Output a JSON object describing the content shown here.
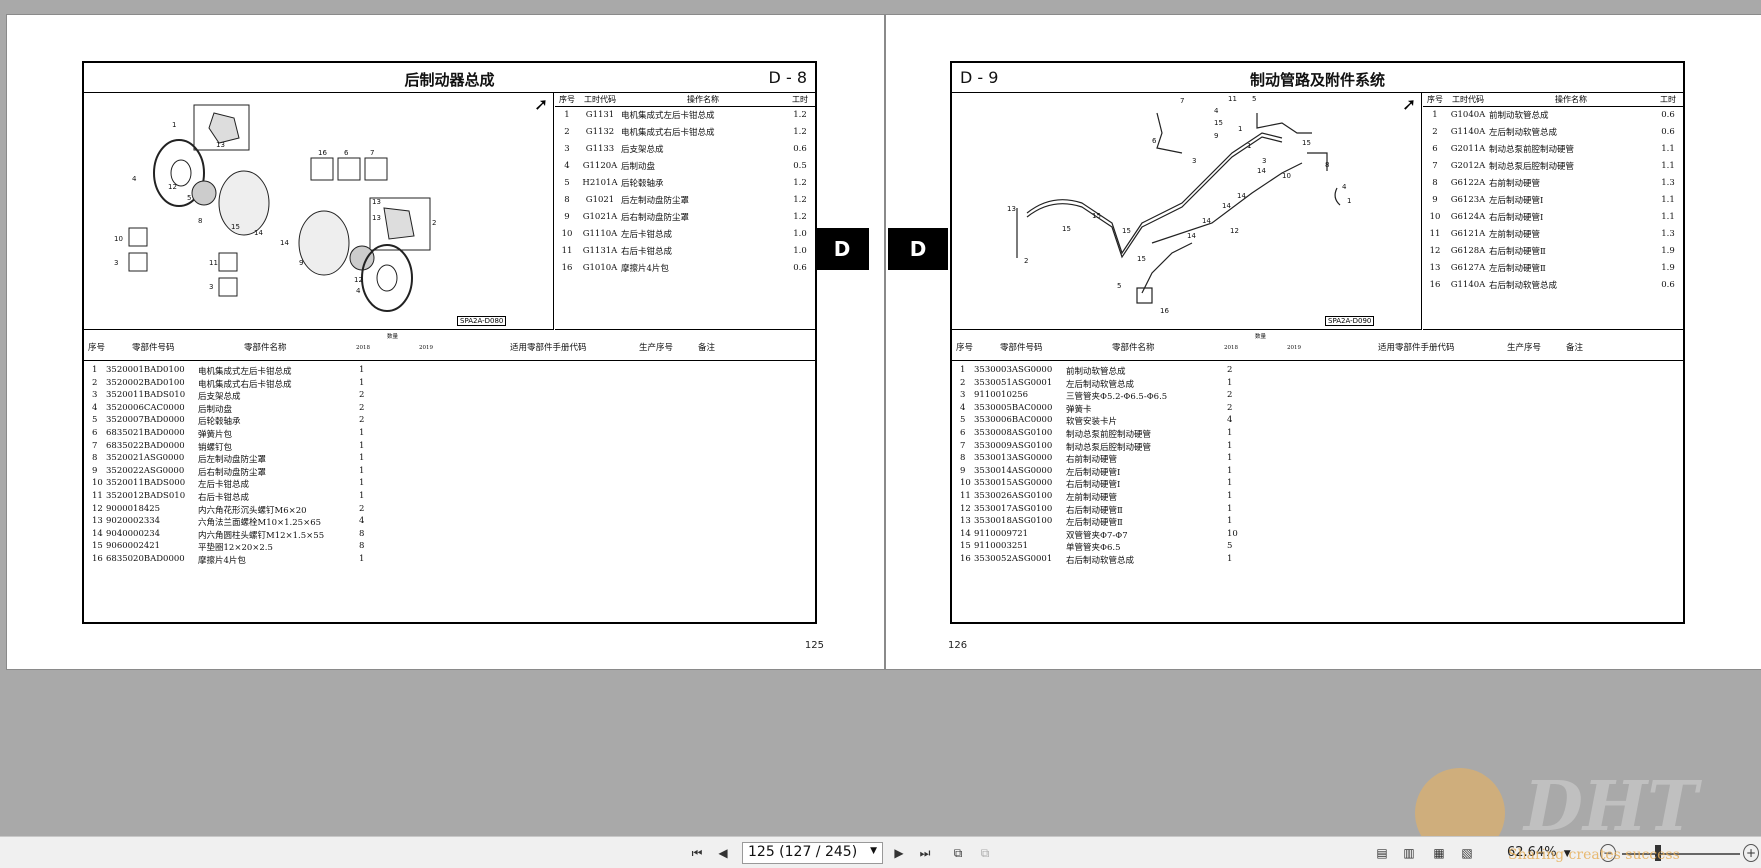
{
  "left_page": {
    "code": "D - 8",
    "title": "后制动器总成",
    "ref": "SPA2A-D080",
    "page_number": "125",
    "ops_headers": {
      "no": "序号",
      "code": "工时代码",
      "name": "操作名称",
      "hours": "工时"
    },
    "ops": [
      {
        "no": "1",
        "code": "G1131",
        "name": "电机集成式左后卡钳总成",
        "hours": "1.2"
      },
      {
        "no": "2",
        "code": "G1132",
        "name": "电机集成式右后卡钳总成",
        "hours": "1.2"
      },
      {
        "no": "3",
        "code": "G1133",
        "name": "后支架总成",
        "hours": "0.6"
      },
      {
        "no": "4",
        "code": "G1120A",
        "name": "后制动盘",
        "hours": "0.5"
      },
      {
        "no": "5",
        "code": "H2101A",
        "name": "后轮毂轴承",
        "hours": "1.2"
      },
      {
        "no": "8",
        "code": "G1021",
        "name": "后左制动盘防尘罩",
        "hours": "1.2"
      },
      {
        "no": "9",
        "code": "G1021A",
        "name": "后右制动盘防尘罩",
        "hours": "1.2"
      },
      {
        "no": "10",
        "code": "G1110A",
        "name": "左后卡钳总成",
        "hours": "1.0"
      },
      {
        "no": "11",
        "code": "G1131A",
        "name": "右后卡钳总成",
        "hours": "1.0"
      },
      {
        "no": "16",
        "code": "G1010A",
        "name": "摩擦片4片包",
        "hours": "0.6"
      }
    ],
    "parts": [
      {
        "no": "1",
        "pn": "3520001BAD0100",
        "name": "电机集成式左后卡钳总成",
        "qty": "1"
      },
      {
        "no": "2",
        "pn": "3520002BAD0100",
        "name": "电机集成式右后卡钳总成",
        "qty": "1"
      },
      {
        "no": "3",
        "pn": "3520011BADS010",
        "name": "后支架总成",
        "qty": "2"
      },
      {
        "no": "4",
        "pn": "3520006CAC0000",
        "name": "后制动盘",
        "qty": "2"
      },
      {
        "no": "5",
        "pn": "3520007BAD0000",
        "name": "后轮毂轴承",
        "qty": "2"
      },
      {
        "no": "6",
        "pn": "6835021BAD0000",
        "name": "弹簧片包",
        "qty": "1"
      },
      {
        "no": "7",
        "pn": "6835022BAD0000",
        "name": "销螺钉包",
        "qty": "1"
      },
      {
        "no": "8",
        "pn": "3520021ASG0000",
        "name": "后左制动盘防尘罩",
        "qty": "1"
      },
      {
        "no": "9",
        "pn": "3520022ASG0000",
        "name": "后右制动盘防尘罩",
        "qty": "1"
      },
      {
        "no": "10",
        "pn": "3520011BADS000",
        "name": "左后卡钳总成",
        "qty": "1"
      },
      {
        "no": "11",
        "pn": "3520012BADS010",
        "name": "右后卡钳总成",
        "qty": "1"
      },
      {
        "no": "12",
        "pn": "9000018425",
        "name": "内六角花形沉头螺钉M6×20",
        "qty": "2"
      },
      {
        "no": "13",
        "pn": "9020002334",
        "name": "六角法兰面螺栓M10×1.25×65",
        "qty": "4"
      },
      {
        "no": "14",
        "pn": "9040000234",
        "name": "内六角圆柱头螺钉M12×1.5×55",
        "qty": "8"
      },
      {
        "no": "15",
        "pn": "9060002421",
        "name": "平垫圈12×20×2.5",
        "qty": "8"
      },
      {
        "no": "16",
        "pn": "6835020BAD0000",
        "name": "摩擦片4片包",
        "qty": "1"
      }
    ]
  },
  "right_page": {
    "code": "D - 9",
    "title": "制动管路及附件系统",
    "ref": "SPA2A-D090",
    "page_number": "126",
    "ops_headers": {
      "no": "序号",
      "code": "工时代码",
      "name": "操作名称",
      "hours": "工时"
    },
    "ops": [
      {
        "no": "1",
        "code": "G1040A",
        "name": "前制动软管总成",
        "hours": "0.6"
      },
      {
        "no": "2",
        "code": "G1140A",
        "name": "左后制动软管总成",
        "hours": "0.6"
      },
      {
        "no": "6",
        "code": "G2011A",
        "name": "制动总泵前腔制动硬管",
        "hours": "1.1"
      },
      {
        "no": "7",
        "code": "G2012A",
        "name": "制动总泵后腔制动硬管",
        "hours": "1.1"
      },
      {
        "no": "8",
        "code": "G6122A",
        "name": "右前制动硬管",
        "hours": "1.3"
      },
      {
        "no": "9",
        "code": "G6123A",
        "name": "左后制动硬管Ⅰ",
        "hours": "1.1"
      },
      {
        "no": "10",
        "code": "G6124A",
        "name": "右后制动硬管Ⅰ",
        "hours": "1.1"
      },
      {
        "no": "11",
        "code": "G6121A",
        "name": "左前制动硬管",
        "hours": "1.3"
      },
      {
        "no": "12",
        "code": "G6128A",
        "name": "右后制动硬管Ⅱ",
        "hours": "1.9"
      },
      {
        "no": "13",
        "code": "G6127A",
        "name": "左后制动硬管Ⅱ",
        "hours": "1.9"
      },
      {
        "no": "16",
        "code": "G1140A",
        "name": "右后制动软管总成",
        "hours": "0.6"
      }
    ],
    "parts": [
      {
        "no": "1",
        "pn": "3530003ASG0000",
        "name": "前制动软管总成",
        "qty": "2"
      },
      {
        "no": "2",
        "pn": "3530051ASG0001",
        "name": "左后制动软管总成",
        "qty": "1"
      },
      {
        "no": "3",
        "pn": "9110010256",
        "name": "三管管夹Φ5.2-Φ6.5-Φ6.5",
        "qty": "2"
      },
      {
        "no": "4",
        "pn": "3530005BAC0000",
        "name": "弹簧卡",
        "qty": "2"
      },
      {
        "no": "5",
        "pn": "3530006BAC0000",
        "name": "软管安装卡片",
        "qty": "4"
      },
      {
        "no": "6",
        "pn": "3530008ASG0100",
        "name": "制动总泵前腔制动硬管",
        "qty": "1"
      },
      {
        "no": "7",
        "pn": "3530009ASG0100",
        "name": "制动总泵后腔制动硬管",
        "qty": "1"
      },
      {
        "no": "8",
        "pn": "3530013ASG0000",
        "name": "右前制动硬管",
        "qty": "1"
      },
      {
        "no": "9",
        "pn": "3530014ASG0000",
        "name": "左后制动硬管Ⅰ",
        "qty": "1"
      },
      {
        "no": "10",
        "pn": "3530015ASG0000",
        "name": "右后制动硬管Ⅰ",
        "qty": "1"
      },
      {
        "no": "11",
        "pn": "3530026ASG0100",
        "name": "左前制动硬管",
        "qty": "1"
      },
      {
        "no": "12",
        "pn": "3530017ASG0100",
        "name": "右后制动硬管Ⅱ",
        "qty": "1"
      },
      {
        "no": "13",
        "pn": "3530018ASG0100",
        "name": "左后制动硬管Ⅱ",
        "qty": "1"
      },
      {
        "no": "14",
        "pn": "9110009721",
        "name": "双管管夹Φ7-Φ7",
        "qty": "10"
      },
      {
        "no": "15",
        "pn": "9110003251",
        "name": "单管管夹Φ6.5",
        "qty": "5"
      },
      {
        "no": "16",
        "pn": "3530052ASG0001",
        "name": "右后制动软管总成",
        "qty": "1"
      }
    ]
  },
  "parts_headers": {
    "no": "序号",
    "pn": "零部件号码",
    "name": "零部件名称",
    "qty": "数量",
    "y1": "2018",
    "y2": "2019",
    "manual": "适用零部件手册代码",
    "seq": "生产序号",
    "note": "备注"
  },
  "section_tab": "D",
  "toolbar": {
    "page_field": "125 (127 / 245)",
    "zoom": "62.64%"
  },
  "watermark": {
    "text": "DHT",
    "sub": "Sharing creates success"
  },
  "colors": {
    "background": "#a9a9a9",
    "tab": "#000000",
    "toolbar": "#f0f0f0"
  }
}
